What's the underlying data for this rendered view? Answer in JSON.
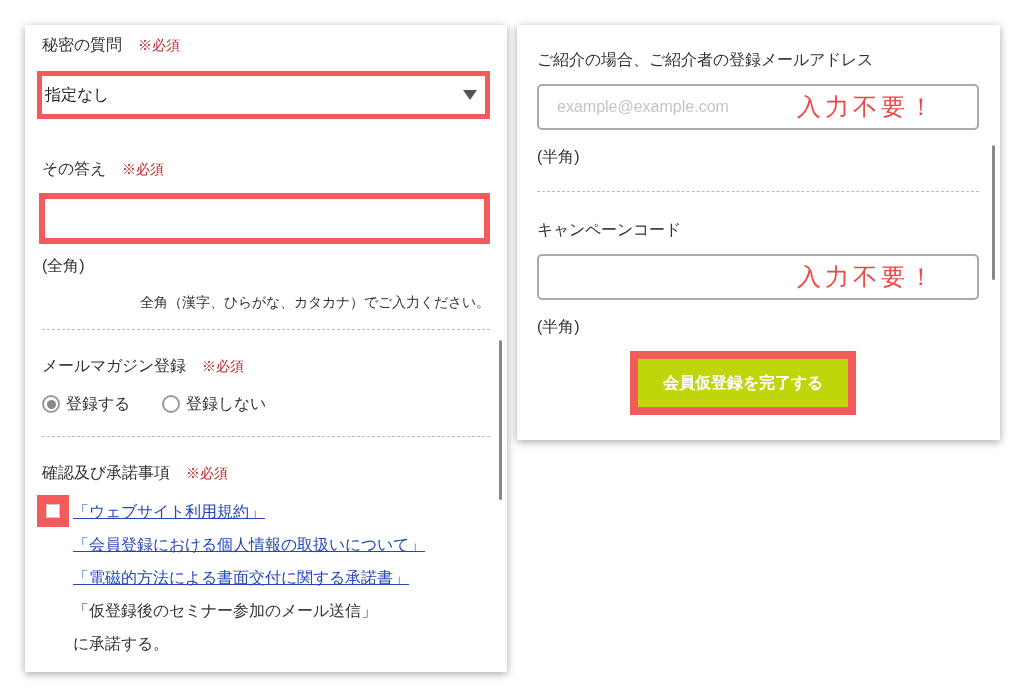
{
  "left_panel": {
    "secret_question": {
      "label": "秘密の質問",
      "required": "※必須",
      "value": "指定なし",
      "highlighted": true
    },
    "answer": {
      "label": "その答え",
      "required": "※必須",
      "highlighted": true,
      "width_note": "(全角)",
      "hint": "全角（漢字、ひらがな、カタカナ）でご入力ください。"
    },
    "newsletter": {
      "label": "メールマガジン登録",
      "required": "※必須",
      "options": [
        {
          "label": "登録する",
          "selected": true
        },
        {
          "label": "登録しない",
          "selected": false
        }
      ]
    },
    "consent": {
      "label": "確認及び承諾事項",
      "required": "※必須",
      "checked": false,
      "highlighted": true,
      "links": [
        "「ウェブサイト利用規約」",
        "「会員登録における個人情報の取扱いについて」",
        "「電磁的方法による書面交付に関する承諾書」"
      ],
      "text_lines": [
        "「仮登録後のセミナー参加のメール送信」",
        "に承諾する。"
      ]
    }
  },
  "right_panel": {
    "referral_email": {
      "label": "ご紹介の場合、ご紹介者の登録メールアドレス",
      "placeholder": "example@example.com",
      "annotation": "入力不要！",
      "width_note": "(半角)"
    },
    "campaign_code": {
      "label": "キャンペーンコード",
      "annotation": "入力不要！",
      "width_note": "(半角)"
    },
    "submit_button": {
      "label": "会員仮登録を完了する",
      "highlighted": true
    }
  }
}
